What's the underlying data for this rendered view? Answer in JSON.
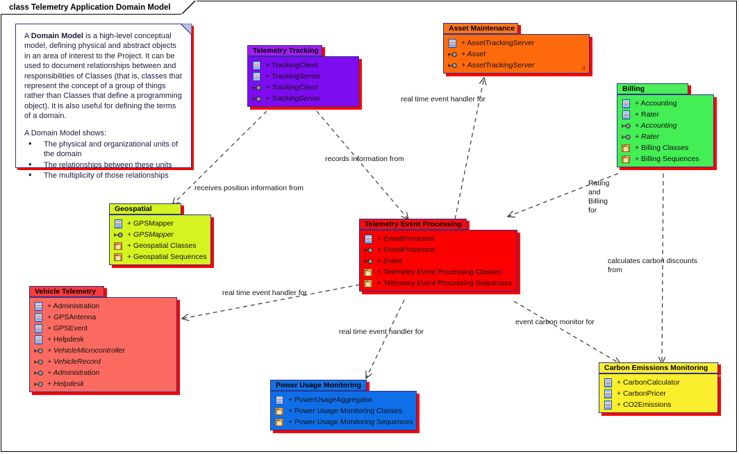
{
  "frame": {
    "title": "class Telemetry Application Domain Model"
  },
  "note": {
    "paragraph1_pre": "A ",
    "paragraph1_bold": "Domain Model",
    "paragraph1_post": " is a high-level conceptual model, defining physical and abstract objects in an area of interest to the Project. It can be used to document relationships between and responsibilities of Classes (that is, classes that represent the concept of a group of things rather than Classes that define a programming object). It is also useful for defining the terms of a domain.",
    "paragraph2": "A Domain Model shows:",
    "bullets": [
      "The physical and organizational units of the domain",
      "The relationships between these units",
      "The multiplicity of those relationships"
    ]
  },
  "packages": [
    {
      "id": "telemetry-tracking",
      "name": "Telemetry Tracking",
      "header_color": "#a01ef0",
      "body_color": "#7d0cf0",
      "items": [
        {
          "icon": "class-icon",
          "label": "+ TrackingClient",
          "italic": false
        },
        {
          "icon": "class-icon",
          "label": "+ TrackingServer",
          "italic": false
        },
        {
          "icon": "interface-icon",
          "label": "+ TrackingClient",
          "italic": true
        },
        {
          "icon": "interface-icon",
          "label": "+ TrackingServer",
          "italic": true
        }
      ]
    },
    {
      "id": "asset-maintenance",
      "name": "Asset Maintenance",
      "header_color": "#ff7518",
      "body_color": "#ff6a0d",
      "marker": "A",
      "items": [
        {
          "icon": "class-icon",
          "label": "+ AssetTrackingServer",
          "italic": false
        },
        {
          "icon": "interface-icon",
          "label": "+ Asset",
          "italic": true
        },
        {
          "icon": "interface-icon",
          "label": "+ AssetTrackingServer",
          "italic": true
        }
      ]
    },
    {
      "id": "billing",
      "name": "Billing",
      "header_color": "#4aee58",
      "body_color": "#44ee55",
      "items": [
        {
          "icon": "class-icon",
          "label": "+ Accounting",
          "italic": false
        },
        {
          "icon": "class-icon",
          "label": "+ Rater",
          "italic": false
        },
        {
          "icon": "interface-icon",
          "label": "+ Accounting",
          "italic": true
        },
        {
          "icon": "interface-icon",
          "label": "+ Rater",
          "italic": true
        },
        {
          "icon": "folder-icon",
          "label": "+ Billing Classes",
          "italic": false
        },
        {
          "icon": "folder-icon",
          "label": "+ Billing Sequences",
          "italic": false
        }
      ]
    },
    {
      "id": "geospatial",
      "name": "Geospatial",
      "header_color": "#d4f321",
      "body_color": "#d4f321",
      "items": [
        {
          "icon": "class-icon",
          "label": "+ GPSMapper",
          "italic": false
        },
        {
          "icon": "interface-icon",
          "label": "+ GPSMapper",
          "italic": true
        },
        {
          "icon": "folder-icon",
          "label": "+ Geospatial Classes",
          "italic": false
        },
        {
          "icon": "folder-icon",
          "label": "+ Geospatial Sequences",
          "italic": false
        }
      ]
    },
    {
      "id": "telemetry-event-processing",
      "name": "Telemetry Event Processing",
      "header_color": "#f40d0d",
      "body_color": "#fb0000",
      "items": [
        {
          "icon": "class-icon",
          "label": "+ EventProcessor",
          "italic": false
        },
        {
          "icon": "interface-icon",
          "label": "+ EventProcessor",
          "italic": true
        },
        {
          "icon": "interface-icon",
          "label": "+ Event",
          "italic": true
        },
        {
          "icon": "folder-icon",
          "label": "+ Telemetry Event Processing Classes",
          "italic": false
        },
        {
          "icon": "folder-icon",
          "label": "+ Telemetry Event Processing Sequences",
          "italic": false
        }
      ]
    },
    {
      "id": "vehicle-telemetry",
      "name": "Vehicle Telemetry",
      "header_color": "#fb3b3b",
      "body_color": "#fb6a60",
      "items": [
        {
          "icon": "class-icon",
          "label": "+ Administration",
          "italic": false
        },
        {
          "icon": "class-icon",
          "label": "+ GPSAntenna",
          "italic": false
        },
        {
          "icon": "class-icon",
          "label": "+ GPSEvent",
          "italic": false
        },
        {
          "icon": "class-icon",
          "label": "+ Helpdesk",
          "italic": false
        },
        {
          "icon": "interface-icon",
          "label": "+ VehicleMicrocontroller",
          "italic": true
        },
        {
          "icon": "interface-icon",
          "label": "+ VehicleRecord",
          "italic": true
        },
        {
          "icon": "interface-icon",
          "label": "+ Administration",
          "italic": true
        },
        {
          "icon": "interface-icon",
          "label": "+ Helpdesk",
          "italic": true
        }
      ]
    },
    {
      "id": "power-usage-monitoring",
      "name": "Power Usage Monitoring",
      "header_color": "#1570e0",
      "body_color": "#0f6fe8",
      "items": [
        {
          "icon": "class-icon",
          "label": "+ PowerUsageAggregator",
          "italic": false
        },
        {
          "icon": "folder-icon",
          "label": "+ Power Usage Monitoring Classes",
          "italic": false
        },
        {
          "icon": "folder-icon",
          "label": "+ Power Usage Monitoring Sequences",
          "italic": false
        }
      ]
    },
    {
      "id": "carbon-emissions-monitoring",
      "name": "Carbon Emissions Monitoring",
      "header_color": "#fbee2c",
      "body_color": "#fbee2c",
      "items": [
        {
          "icon": "class-icon",
          "label": "+ CarbonCalculator",
          "italic": false
        },
        {
          "icon": "class-icon",
          "label": "+ CarbonPricer",
          "italic": false
        },
        {
          "icon": "class-icon",
          "label": "+ CO2Emissions",
          "italic": false
        }
      ]
    }
  ],
  "connector_labels": [
    {
      "id": "label-receives-position-information-from",
      "text": "receives position information from"
    },
    {
      "id": "label-records-information-from",
      "text": "records information from"
    },
    {
      "id": "label-rt-handler-asset",
      "text": "real time event handler for"
    },
    {
      "id": "label-rating-and-billing-for",
      "text": "Rating and Billing for"
    },
    {
      "id": "label-calculates-carbon-discounts-from",
      "text": "calculates carbon discounts from"
    },
    {
      "id": "label-rt-handler-vehicle",
      "text": "real time event handler for"
    },
    {
      "id": "label-rt-handler-power",
      "text": "real time event handler for"
    },
    {
      "id": "label-event-carbon-monitor-for",
      "text": "event carbon monitor for"
    }
  ],
  "colors": {
    "border": "#2a3390",
    "shadow": "#ff0000",
    "connector": "#333333"
  }
}
